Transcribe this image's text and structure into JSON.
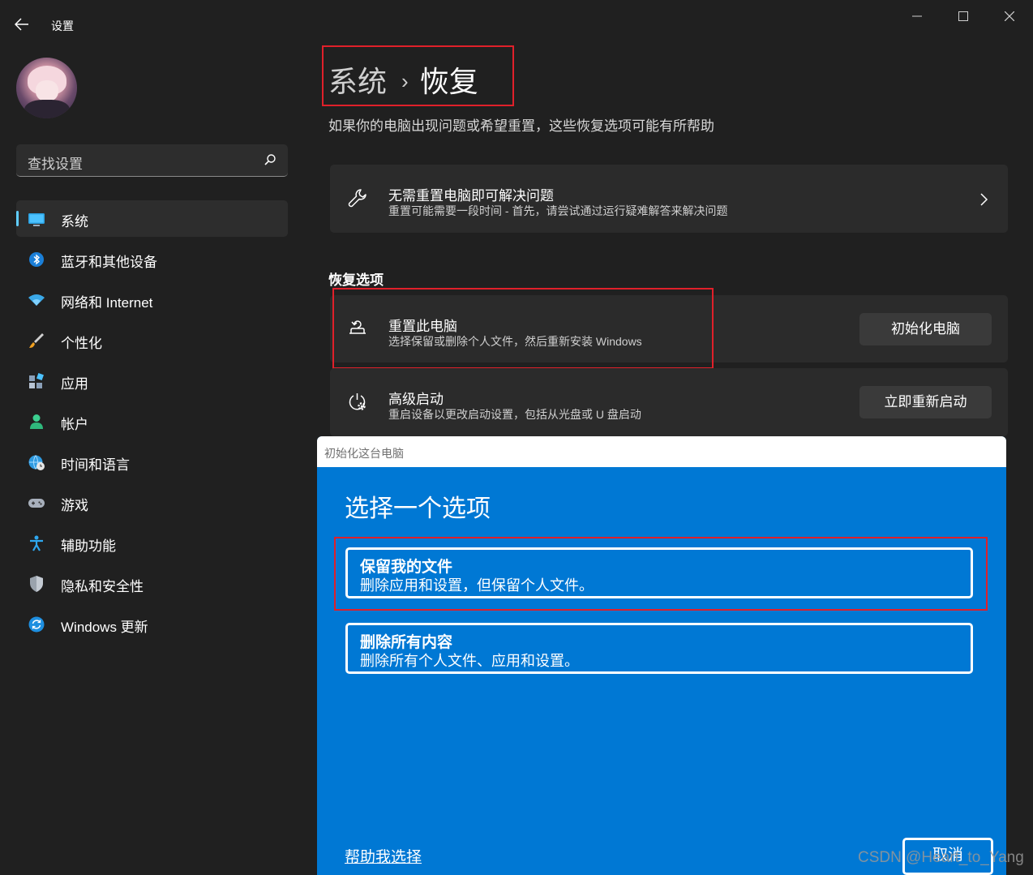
{
  "app": {
    "title": "设置",
    "back_icon": "arrow-left-icon"
  },
  "window_controls": [
    "minimize-icon",
    "maximize-icon",
    "close-icon"
  ],
  "search": {
    "placeholder": "查找设置",
    "icon": "search-icon"
  },
  "sidebar": {
    "items": [
      {
        "label": "系统",
        "icon": "monitor-icon",
        "active": true
      },
      {
        "label": "蓝牙和其他设备",
        "icon": "bluetooth-icon"
      },
      {
        "label": "网络和 Internet",
        "icon": "wifi-icon"
      },
      {
        "label": "个性化",
        "icon": "brush-icon"
      },
      {
        "label": "应用",
        "icon": "apps-icon"
      },
      {
        "label": "帐户",
        "icon": "person-icon"
      },
      {
        "label": "时间和语言",
        "icon": "globe-clock-icon"
      },
      {
        "label": "游戏",
        "icon": "gamepad-icon"
      },
      {
        "label": "辅助功能",
        "icon": "accessibility-icon"
      },
      {
        "label": "隐私和安全性",
        "icon": "shield-icon"
      },
      {
        "label": "Windows 更新",
        "icon": "refresh-icon"
      }
    ]
  },
  "header": {
    "breadcrumb_parent": "系统",
    "breadcrumb_sep": "›",
    "breadcrumb_current": "恢复",
    "subtitle": "如果你的电脑出现问题或希望重置，这些恢复选项可能有所帮助"
  },
  "troubleshoot_card": {
    "title": "无需重置电脑即可解决问题",
    "desc": "重置可能需要一段时间 - 首先，请尝试通过运行疑难解答来解决问题",
    "icon": "wrench-icon"
  },
  "recovery": {
    "section_title": "恢复选项",
    "reset": {
      "title": "重置此电脑",
      "desc": "选择保留或删除个人文件，然后重新安装 Windows",
      "button": "初始化电脑",
      "icon": "reset-pc-icon"
    },
    "advanced": {
      "title": "高级启动",
      "desc": "重启设备以更改启动设置，包括从光盘或 U 盘启动",
      "button": "立即重新启动",
      "icon": "power-gear-icon"
    }
  },
  "dialog": {
    "title": "初始化这台电脑",
    "heading": "选择一个选项",
    "options": [
      {
        "title": "保留我的文件",
        "desc": "删除应用和设置，但保留个人文件。"
      },
      {
        "title": "删除所有内容",
        "desc": "删除所有个人文件、应用和设置。"
      }
    ],
    "help_link": "帮助我选择",
    "cancel": "取消"
  },
  "watermark": "CSDN @Heart_to_Yang",
  "colors": {
    "background": "#202020",
    "card": "#2b2b2b",
    "accent": "#60cdff",
    "dialog_blue": "#0078d4",
    "highlight_red": "#e0202a"
  }
}
